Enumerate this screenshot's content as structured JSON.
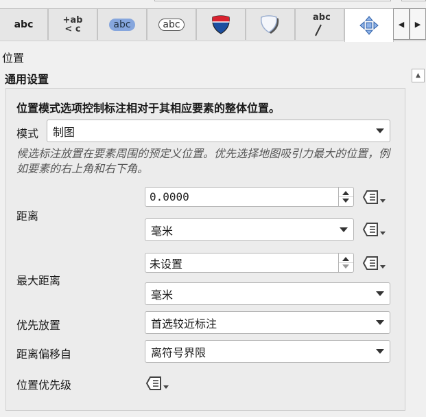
{
  "tabs": [
    {
      "name": "text",
      "label": "abc"
    },
    {
      "name": "formatting",
      "label_top": "+ab",
      "label_bottom": "< c"
    },
    {
      "name": "buffer",
      "label": "abc"
    },
    {
      "name": "mask",
      "label": "abc"
    },
    {
      "name": "background",
      "icon": "highway-shield-icon"
    },
    {
      "name": "shadow",
      "icon": "shadow-shield-icon"
    },
    {
      "name": "callouts",
      "label": "abc"
    },
    {
      "name": "placement",
      "icon": "move-arrows-icon",
      "active": true
    }
  ],
  "section_title": "位置",
  "group": {
    "title": "通用设置",
    "description": "位置模式选项控制标注相对于其相应要素的整体位置。",
    "mode_label": "模式",
    "mode_value": "制图",
    "hint": "候选标注放置在要素周围的预定义位置。优先选择地图吸引力最大的位置，例如要素的右上角和右下角。",
    "distance_label": "距离",
    "distance_value": "0.0000",
    "distance_unit": "毫米",
    "max_distance_label": "最大距离",
    "max_distance_value": "未设置",
    "max_distance_unit": "毫米",
    "preferred_placement_label": "优先放置",
    "preferred_placement_value": "首选较近标注",
    "offset_from_label": "距离偏移自",
    "offset_from_value": "离符号界限",
    "position_priority_label": "位置优先级"
  },
  "colors": {
    "accent": "#1f5fbf",
    "shield_red": "#d8222f",
    "shield_blue": "#1c4fa0"
  }
}
